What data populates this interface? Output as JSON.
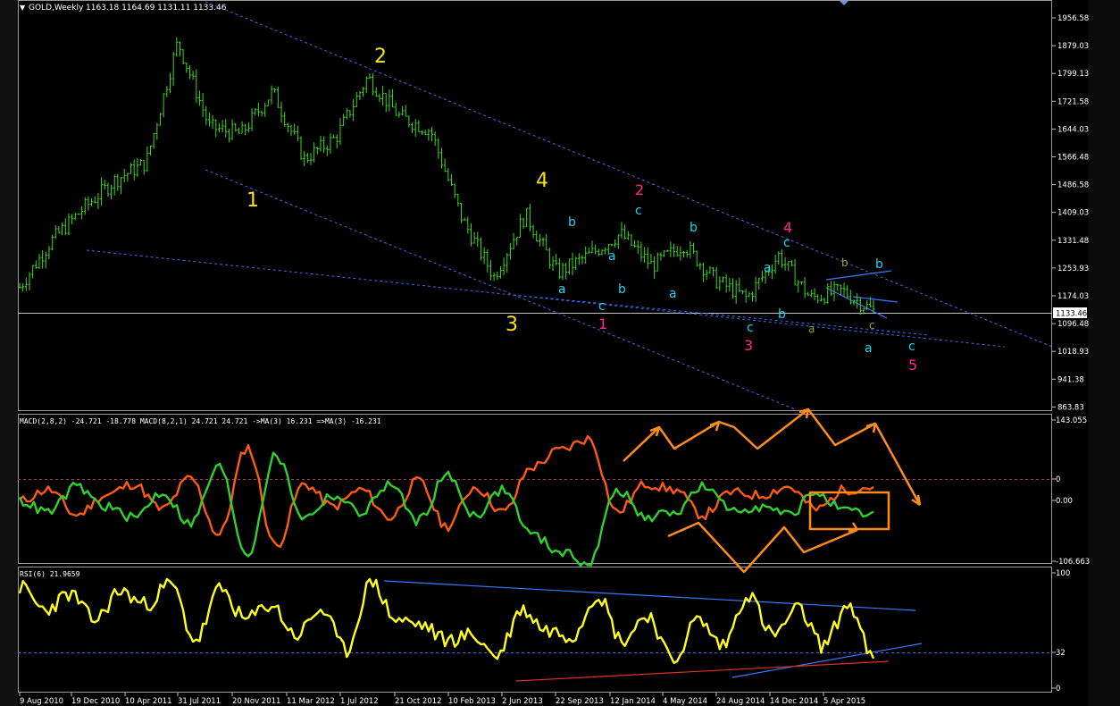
{
  "chart_header": {
    "symbol": "GOLD,Weekly",
    "ohlc": "1163.18 1164.69 1131.11 1133.46",
    "current_price": "1133.46"
  },
  "colors": {
    "background": "#000000",
    "price_bars": "#3bd81c",
    "grid_text": "#ffffff",
    "trendline_blue": "#4169e1",
    "label_yellow": "#f5e21b",
    "label_cyan": "#19d6f0",
    "label_magenta": "#ff2a8a",
    "label_olive": "#9a9a3a",
    "macd_green": "#2fd12f",
    "macd_orange": "#ff5a14",
    "annotation_orange": "#ff8c1a",
    "rsi_yellow": "#ffff1a"
  },
  "price_axis": {
    "ticks": [
      "1956.58",
      "1879.03",
      "1799.13",
      "1721.58",
      "1644.03",
      "1566.48",
      "1486.58",
      "1409.03",
      "1331.48",
      "1253.93",
      "1174.03",
      "1096.48",
      "1018.93",
      "941.38",
      "863.83"
    ]
  },
  "macd_panel": {
    "label": "MACD(2,8,2) -24.721 -18.778  MACD(8,2,1) 24.721 24.721  ->MA(3) 16.231  =>MA(3) -16.231",
    "ticks": [
      "143.055",
      "0",
      "0.00",
      "-106.663"
    ]
  },
  "rsi_panel": {
    "label": "RSI(6) 21.9659",
    "ticks": [
      "100",
      "32",
      "0"
    ]
  },
  "date_axis": {
    "labels": [
      "9 Aug 2010",
      "19 Dec 2010",
      "10 Apr 2011",
      "31 Jul 2011",
      "20 Nov 2011",
      "11 Mar 2012",
      "1 Jul 2012",
      "21 Oct 2012",
      "10 Feb 2013",
      "2 Jun 2013",
      "22 Sep 2013",
      "12 Jan 2014",
      "4 May 2014",
      "24 Aug 2014",
      "14 Dec 2014",
      "5 Apr 2015"
    ]
  },
  "wave_labels": {
    "yellow": [
      "1",
      "2",
      "3",
      "4"
    ],
    "magenta": [
      "1",
      "2",
      "3",
      "4",
      "5"
    ],
    "cyan": [
      "a",
      "b",
      "c",
      "a",
      "b",
      "c",
      "a",
      "b",
      "c",
      "a",
      "b",
      "c",
      "b",
      "a",
      "c"
    ],
    "olive": [
      "a",
      "b",
      "c"
    ]
  },
  "chart_data": [
    {
      "type": "ohlc",
      "symbol": "GOLD",
      "timeframe": "Weekly",
      "x": [
        "2010-07",
        "2010-10",
        "2011-01",
        "2011-04",
        "2011-06",
        "2011-08",
        "2011-09",
        "2011-12",
        "2012-02",
        "2012-05",
        "2012-08",
        "2012-10",
        "2012-12",
        "2013-02",
        "2013-04",
        "2013-06",
        "2013-08",
        "2013-11",
        "2014-01",
        "2014-03",
        "2014-06",
        "2014-07",
        "2014-09",
        "2014-11",
        "2015-01",
        "2015-03",
        "2015-05",
        "2015-07"
      ],
      "close": [
        1200,
        1330,
        1420,
        1500,
        1550,
        1890,
        1650,
        1630,
        1750,
        1560,
        1620,
        1790,
        1680,
        1640,
        1390,
        1230,
        1405,
        1240,
        1290,
        1350,
        1260,
        1320,
        1220,
        1170,
        1290,
        1170,
        1190,
        1133.46
      ],
      "ylim": [
        863.83,
        1956.58
      ]
    },
    {
      "type": "line",
      "indicator": "MACD",
      "series": [
        {
          "name": "MACD(2,8,2)",
          "values": [
            0,
            20,
            -25,
            10,
            30,
            -15,
            40,
            -60,
            95,
            -80,
            30,
            -10,
            20,
            -30,
            35,
            -45,
            25,
            -20,
            60,
            90,
            110,
            -20,
            30,
            20,
            -25,
            15,
            10,
            25,
            -15,
            20,
            24.721
          ]
        },
        {
          "name": "MACD(8,2,1)",
          "values": [
            0,
            -20,
            25,
            -10,
            -30,
            15,
            -40,
            60,
            -95,
            80,
            -30,
            10,
            -20,
            30,
            -35,
            45,
            -25,
            20,
            -60,
            -90,
            -110,
            20,
            -30,
            -20,
            25,
            -15,
            -10,
            -25,
            15,
            -20,
            -24.721
          ]
        }
      ],
      "ylim": [
        -106.663,
        143.055
      ]
    },
    {
      "type": "line",
      "indicator": "RSI(6)",
      "values": [
        92,
        70,
        85,
        60,
        88,
        75,
        95,
        40,
        90,
        60,
        75,
        45,
        70,
        30,
        98,
        60,
        55,
        40,
        45,
        25,
        70,
        50,
        45,
        85,
        40,
        65,
        20,
        60,
        35,
        85,
        45,
        70,
        35,
        75,
        21.9659
      ],
      "ylim": [
        0,
        100
      ],
      "reference_line": 32
    }
  ]
}
